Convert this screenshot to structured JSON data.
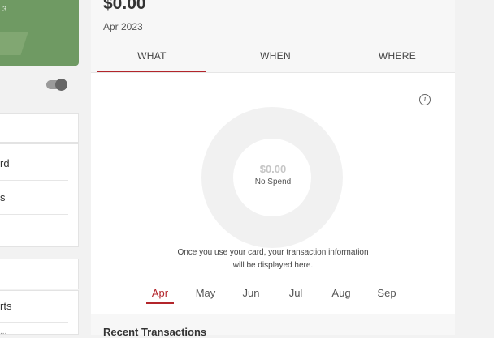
{
  "sidebar": {
    "card_digit": "3",
    "list_b": [
      "rd",
      "s",
      ""
    ],
    "list_d": [
      "rts",
      "..."
    ]
  },
  "summary": {
    "amount": "$0.00",
    "period": "Apr 2023"
  },
  "tabs": [
    {
      "label": "WHAT",
      "active": true
    },
    {
      "label": "WHEN",
      "active": false
    },
    {
      "label": "WHERE",
      "active": false
    }
  ],
  "chart": {
    "amount": "$0.00",
    "caption": "No Spend",
    "empty_message_line1": "Once you use your card, your transaction information",
    "empty_message_line2": "will be displayed here."
  },
  "months": [
    "Apr",
    "May",
    "Jun",
    "Jul",
    "Aug",
    "Sep"
  ],
  "selected_month": "Apr",
  "recent_transactions_title": "Recent Transactions",
  "colors": {
    "accent": "#b3252b",
    "card_green": "#6f9a63"
  }
}
